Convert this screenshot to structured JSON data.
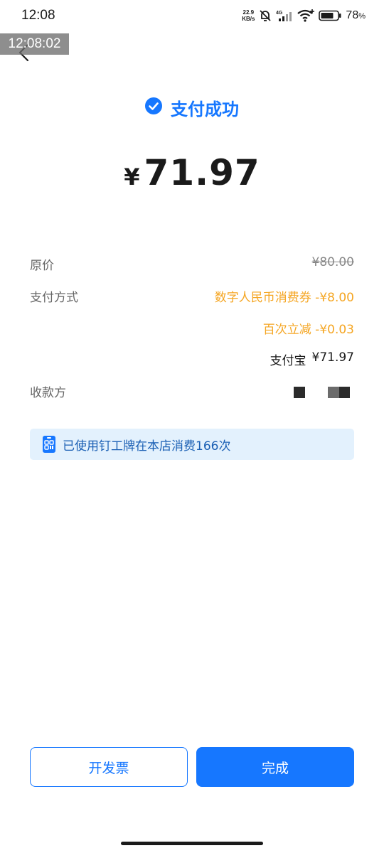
{
  "status_bar": {
    "time": "12:08",
    "net_speed_value": "22.9",
    "net_speed_unit": "KB/s",
    "signal_label": "4G",
    "battery": "78",
    "battery_unit": "%"
  },
  "overlay_time": "12:08:02",
  "header": {
    "result_title": "支付成功",
    "currency": "¥",
    "amount": "71.97"
  },
  "details": {
    "original_label": "原价",
    "original_value": "¥80.00",
    "method_label": "支付方式",
    "discounts": [
      "数字人民币消费券 -¥8.00",
      "百次立减 -¥0.03"
    ],
    "paid_method": "支付宝",
    "paid_amount": "¥71.97",
    "payee_label": "收款方"
  },
  "banner": {
    "text": "已使用钉工牌在本店消费166次"
  },
  "buttons": {
    "invoice": "开发票",
    "done": "完成"
  },
  "colors": {
    "accent": "#1677ff",
    "discount": "#f5a623",
    "banner_bg": "#e3f1fd"
  }
}
